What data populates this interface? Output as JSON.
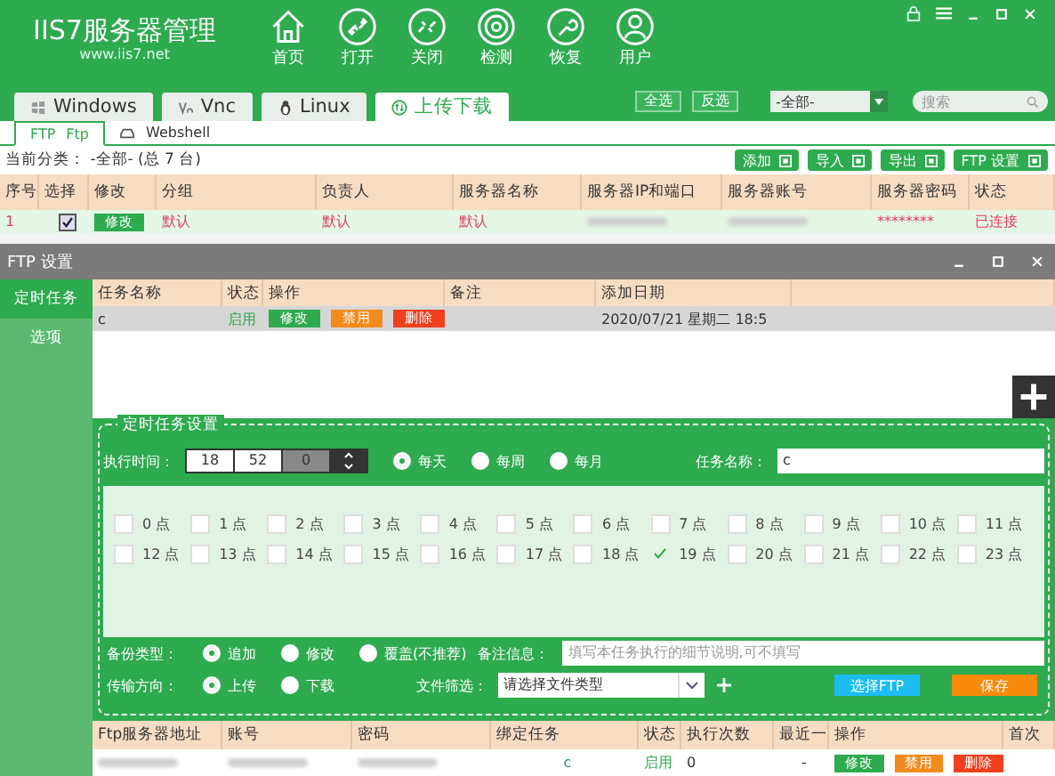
{
  "header": {
    "logo": "IIS7服务器管理",
    "url": "www.iis7.net",
    "nav": [
      {
        "label": "首页",
        "kind": "home"
      },
      {
        "label": "打开",
        "kind": "link"
      },
      {
        "label": "关闭",
        "kind": "unlink"
      },
      {
        "label": "检测",
        "kind": "radar"
      },
      {
        "label": "恢复",
        "kind": "wrench"
      },
      {
        "label": "用户",
        "kind": "user"
      }
    ]
  },
  "tabs": [
    {
      "label": "Windows",
      "kind": "windows",
      "selected": false
    },
    {
      "label": "Vnc",
      "kind": "vnc",
      "selected": false
    },
    {
      "label": "Linux",
      "kind": "linux",
      "selected": false
    },
    {
      "label": "上传下载",
      "kind": "transfer",
      "selected": true
    }
  ],
  "toolbar": {
    "select_all": "全选",
    "invert": "反选",
    "group": "-全部-",
    "search_placeholder": "搜索"
  },
  "subtabs": [
    {
      "prefix": "FTP",
      "label": "Ftp",
      "selected": true
    },
    {
      "label": "Webshell",
      "selected": false
    }
  ],
  "category": "当前分类： -全部- (总 7 台)",
  "actions": [
    "添加",
    "导入",
    "导出",
    "FTP 设置"
  ],
  "table": {
    "columns": [
      "序号",
      "选择",
      "修改",
      "分组",
      "负责人",
      "服务器名称",
      "服务器IP和端口",
      "服务器账号",
      "服务器密码",
      "状态"
    ],
    "rows": [
      {
        "no": "1",
        "checked": true,
        "edit": "修改",
        "group": "默认",
        "owner": "默认",
        "name": "默认",
        "password": "********",
        "status": "已连接"
      }
    ]
  },
  "dialog": {
    "title": "FTP 设置",
    "sidebar": [
      {
        "label": "定时任务",
        "selected": true
      },
      {
        "label": "选项",
        "selected": false
      }
    ],
    "tasks": {
      "columns": [
        "任务名称",
        "状态",
        "操作",
        "备注",
        "添加日期"
      ],
      "rows": [
        {
          "name": "c",
          "status": "启用",
          "edit": "修改",
          "disable": "禁用",
          "delete": "删除",
          "date": "2020/07/21 星期二 18:5"
        }
      ]
    },
    "settings": {
      "legend": "定时任务设置",
      "time_label": "执行时间：",
      "hour": "18",
      "minute": "52",
      "second": "0",
      "frequency": [
        {
          "label": "每天",
          "selected": true
        },
        {
          "label": "每周",
          "selected": false
        },
        {
          "label": "每月",
          "selected": false
        }
      ],
      "name_label": "任务名称：",
      "name_value": "c",
      "hours": [
        {
          "label": "0 点",
          "checked": false
        },
        {
          "label": "1 点",
          "checked": false
        },
        {
          "label": "2 点",
          "checked": false
        },
        {
          "label": "3 点",
          "checked": false
        },
        {
          "label": "4 点",
          "checked": false
        },
        {
          "label": "5 点",
          "checked": false
        },
        {
          "label": "6 点",
          "checked": false
        },
        {
          "label": "7 点",
          "checked": false
        },
        {
          "label": "8 点",
          "checked": false
        },
        {
          "label": "9 点",
          "checked": false
        },
        {
          "label": "10 点",
          "checked": false
        },
        {
          "label": "11 点",
          "checked": false
        },
        {
          "label": "12 点",
          "checked": false
        },
        {
          "label": "13 点",
          "checked": false
        },
        {
          "label": "14 点",
          "checked": false
        },
        {
          "label": "15 点",
          "checked": false
        },
        {
          "label": "16 点",
          "checked": false
        },
        {
          "label": "17 点",
          "checked": false
        },
        {
          "label": "18 点",
          "checked": false
        },
        {
          "label": "19 点",
          "checked": true
        },
        {
          "label": "20 点",
          "checked": false
        },
        {
          "label": "21 点",
          "checked": false
        },
        {
          "label": "22 点",
          "checked": false
        },
        {
          "label": "23 点",
          "checked": false
        }
      ],
      "backup_label": "备份类型：",
      "backup": [
        {
          "label": "追加",
          "selected": true
        },
        {
          "label": "修改",
          "selected": false
        },
        {
          "label": "覆盖(不推荐)",
          "selected": false
        }
      ],
      "note_label": "备注信息：",
      "note_placeholder": "填写本任务执行的细节说明,可不填写",
      "direction_label": "传输方向：",
      "direction": [
        {
          "label": "上传",
          "selected": true
        },
        {
          "label": "下载",
          "selected": false
        }
      ],
      "filter_label": "文件筛选：",
      "filter_value": "请选择文件类型",
      "choose_ftp": "选择FTP",
      "save": "保存"
    },
    "ftp": {
      "columns": [
        "Ftp服务器地址",
        "账号",
        "密码",
        "绑定任务",
        "状态",
        "执行次数",
        "最近一",
        "操作",
        "首次"
      ],
      "rows": [
        {
          "task": "c",
          "status": "启用",
          "count": "0",
          "last": "-",
          "edit": "修改",
          "disable": "禁用",
          "delete": "删除"
        }
      ]
    }
  }
}
